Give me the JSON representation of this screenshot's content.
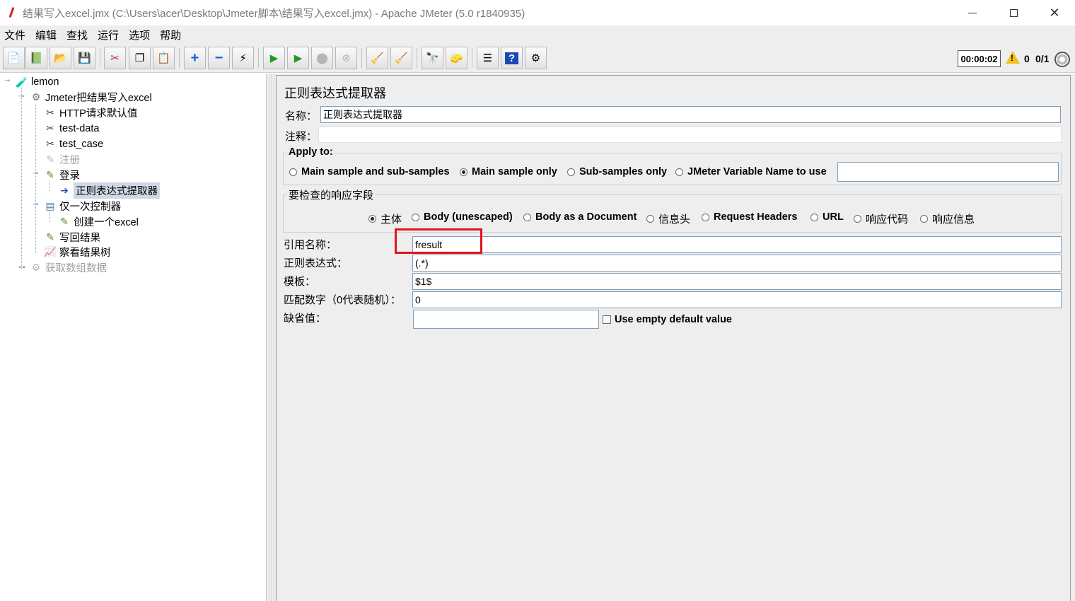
{
  "window": {
    "title": "结果写入excel.jmx (C:\\Users\\acer\\Desktop\\Jmeter脚本\\结果写入excel.jmx) - Apache JMeter (5.0 r1840935)",
    "controls": {
      "minimize": "—",
      "maximize": "☐",
      "close": "✕"
    }
  },
  "menu": [
    "文件",
    "编辑",
    "查找",
    "运行",
    "选项",
    "帮助"
  ],
  "toolbar": {
    "buttons": [
      {
        "name": "new-icon",
        "glyph": "📄"
      },
      {
        "name": "templates-icon",
        "glyph": "📗"
      },
      {
        "name": "open-icon",
        "glyph": "📂"
      },
      {
        "name": "save-icon",
        "glyph": "💾"
      },
      {
        "name": "cut-icon",
        "glyph": "✂"
      },
      {
        "name": "copy-icon",
        "glyph": "❐"
      },
      {
        "name": "paste-icon",
        "glyph": "📋"
      },
      {
        "name": "expand-icon",
        "glyph": "+"
      },
      {
        "name": "collapse-icon",
        "glyph": "−"
      },
      {
        "name": "toggle-icon",
        "glyph": "⚡"
      },
      {
        "name": "start-icon",
        "glyph": "▶"
      },
      {
        "name": "start-no-pause-icon",
        "glyph": "▶"
      },
      {
        "name": "stop-icon",
        "glyph": "⬤"
      },
      {
        "name": "shutdown-icon",
        "glyph": "⊗"
      },
      {
        "name": "clear-icon",
        "glyph": "🧹"
      },
      {
        "name": "clear-all-icon",
        "glyph": "🧹"
      },
      {
        "name": "search-icon",
        "glyph": "🔭"
      },
      {
        "name": "reset-search-icon",
        "glyph": "🧽"
      },
      {
        "name": "function-helper-icon",
        "glyph": "☰"
      },
      {
        "name": "help-icon",
        "glyph": "?"
      },
      {
        "name": "remote-icon",
        "glyph": "⚙"
      }
    ],
    "timer": "00:00:02",
    "warnings": "0",
    "threads": "0/1"
  },
  "tree": [
    {
      "label": "lemon",
      "icon": "flask-icon",
      "glyph": "🧪",
      "disabled": false,
      "selected": false
    },
    {
      "label": "Jmeter把结果写入excel",
      "icon": "thread-group-icon",
      "glyph": "⚙",
      "disabled": false,
      "selected": false
    },
    {
      "label": "HTTP请求默认值",
      "icon": "config-icon",
      "glyph": "✂",
      "disabled": false,
      "selected": false
    },
    {
      "label": "test-data",
      "icon": "config-icon",
      "glyph": "✂",
      "disabled": false,
      "selected": false
    },
    {
      "label": "test_case",
      "icon": "config-icon",
      "glyph": "✂",
      "disabled": false,
      "selected": false
    },
    {
      "label": "注册",
      "icon": "sampler-icon",
      "glyph": "✎",
      "disabled": true,
      "selected": false
    },
    {
      "label": "登录",
      "icon": "sampler-icon",
      "glyph": "✎",
      "disabled": false,
      "selected": false
    },
    {
      "label": "正则表达式提取器",
      "icon": "extractor-icon",
      "glyph": "➔",
      "disabled": false,
      "selected": true
    },
    {
      "label": "仅一次控制器",
      "icon": "controller-icon",
      "glyph": "▤",
      "disabled": false,
      "selected": false
    },
    {
      "label": "创建一个excel",
      "icon": "sampler-icon",
      "glyph": "✎",
      "disabled": false,
      "selected": false
    },
    {
      "label": "写回结果",
      "icon": "sampler-icon",
      "glyph": "✎",
      "disabled": false,
      "selected": false
    },
    {
      "label": "察看结果树",
      "icon": "listener-icon",
      "glyph": "📈",
      "disabled": false,
      "selected": false
    },
    {
      "label": "获取数组数据",
      "icon": "thread-group-icon",
      "glyph": "⚙",
      "disabled": true,
      "selected": false
    }
  ],
  "panel": {
    "title": "正则表达式提取器",
    "name_label": "名称：",
    "name_value": "正则表达式提取器",
    "comment_label": "注释：",
    "comment_value": "",
    "apply_to": {
      "title": "Apply to:",
      "options": [
        "Main sample and sub-samples",
        "Main sample only",
        "Sub-samples only",
        "JMeter Variable Name to use"
      ],
      "selected": 1,
      "variable_value": ""
    },
    "field_to_check": {
      "title": "要检查的响应字段",
      "options": [
        "主体",
        "Body (unescaped)",
        "Body as a Document",
        "信息头",
        "Request Headers",
        "URL",
        "响应代码",
        "响应信息"
      ],
      "selected": 0
    },
    "ref_name_label": "引用名称：",
    "ref_name_value": "fresult",
    "regex_label": "正则表达式：",
    "regex_value": "(.*)",
    "template_label": "模板：",
    "template_value": "$1$",
    "match_no_label": "匹配数字（0代表随机）：",
    "match_no_value": "0",
    "default_label": "缺省值：",
    "default_value": "",
    "use_empty_default": "Use empty default value"
  }
}
